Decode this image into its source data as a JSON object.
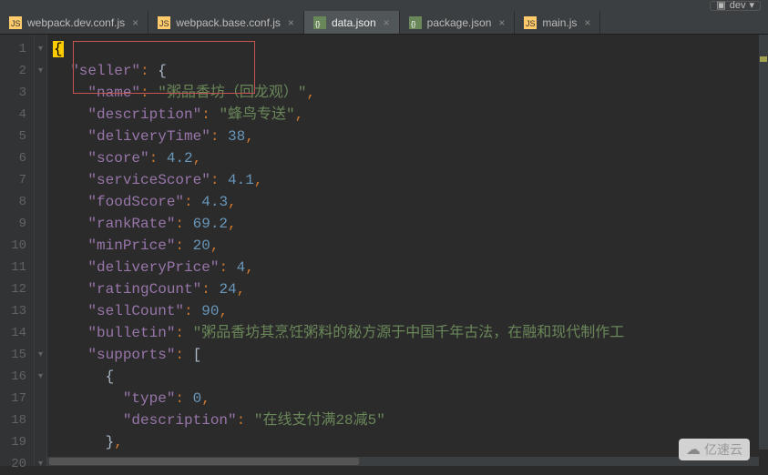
{
  "topbar": {
    "config_name": "dev"
  },
  "tabs": [
    {
      "label": "webpack.dev.conf.js",
      "icon": "js",
      "active": false
    },
    {
      "label": "webpack.base.conf.js",
      "icon": "js",
      "active": false
    },
    {
      "label": "data.json",
      "icon": "json",
      "active": true
    },
    {
      "label": "package.json",
      "icon": "json",
      "active": false
    },
    {
      "label": "main.js",
      "icon": "js",
      "active": false
    }
  ],
  "code": {
    "lines": [
      {
        "num": 1,
        "indent": 0,
        "tokens": [
          {
            "t": "caret",
            "v": "{"
          }
        ]
      },
      {
        "num": 2,
        "indent": 1,
        "tokens": [
          {
            "t": "k",
            "v": "\"seller\""
          },
          {
            "t": "p",
            "v": ": "
          },
          {
            "t": "w",
            "v": "{"
          }
        ]
      },
      {
        "num": 3,
        "indent": 2,
        "tokens": [
          {
            "t": "k",
            "v": "\"name\""
          },
          {
            "t": "p",
            "v": ": "
          },
          {
            "t": "s",
            "v": "\"粥品香坊（回龙观）\""
          },
          {
            "t": "p",
            "v": ","
          }
        ]
      },
      {
        "num": 4,
        "indent": 2,
        "tokens": [
          {
            "t": "k",
            "v": "\"description\""
          },
          {
            "t": "p",
            "v": ": "
          },
          {
            "t": "s",
            "v": "\"蜂鸟专送\""
          },
          {
            "t": "p",
            "v": ","
          }
        ]
      },
      {
        "num": 5,
        "indent": 2,
        "tokens": [
          {
            "t": "k",
            "v": "\"deliveryTime\""
          },
          {
            "t": "p",
            "v": ": "
          },
          {
            "t": "n",
            "v": "38"
          },
          {
            "t": "p",
            "v": ","
          }
        ]
      },
      {
        "num": 6,
        "indent": 2,
        "tokens": [
          {
            "t": "k",
            "v": "\"score\""
          },
          {
            "t": "p",
            "v": ": "
          },
          {
            "t": "n",
            "v": "4.2"
          },
          {
            "t": "p",
            "v": ","
          }
        ]
      },
      {
        "num": 7,
        "indent": 2,
        "tokens": [
          {
            "t": "k",
            "v": "\"serviceScore\""
          },
          {
            "t": "p",
            "v": ": "
          },
          {
            "t": "n",
            "v": "4.1"
          },
          {
            "t": "p",
            "v": ","
          }
        ]
      },
      {
        "num": 8,
        "indent": 2,
        "tokens": [
          {
            "t": "k",
            "v": "\"foodScore\""
          },
          {
            "t": "p",
            "v": ": "
          },
          {
            "t": "n",
            "v": "4.3"
          },
          {
            "t": "p",
            "v": ","
          }
        ]
      },
      {
        "num": 9,
        "indent": 2,
        "tokens": [
          {
            "t": "k",
            "v": "\"rankRate\""
          },
          {
            "t": "p",
            "v": ": "
          },
          {
            "t": "n",
            "v": "69.2"
          },
          {
            "t": "p",
            "v": ","
          }
        ]
      },
      {
        "num": 10,
        "indent": 2,
        "tokens": [
          {
            "t": "k",
            "v": "\"minPrice\""
          },
          {
            "t": "p",
            "v": ": "
          },
          {
            "t": "n",
            "v": "20"
          },
          {
            "t": "p",
            "v": ","
          }
        ]
      },
      {
        "num": 11,
        "indent": 2,
        "tokens": [
          {
            "t": "k",
            "v": "\"deliveryPrice\""
          },
          {
            "t": "p",
            "v": ": "
          },
          {
            "t": "n",
            "v": "4"
          },
          {
            "t": "p",
            "v": ","
          }
        ]
      },
      {
        "num": 12,
        "indent": 2,
        "tokens": [
          {
            "t": "k",
            "v": "\"ratingCount\""
          },
          {
            "t": "p",
            "v": ": "
          },
          {
            "t": "n",
            "v": "24"
          },
          {
            "t": "p",
            "v": ","
          }
        ]
      },
      {
        "num": 13,
        "indent": 2,
        "tokens": [
          {
            "t": "k",
            "v": "\"sellCount\""
          },
          {
            "t": "p",
            "v": ": "
          },
          {
            "t": "n",
            "v": "90"
          },
          {
            "t": "p",
            "v": ","
          }
        ]
      },
      {
        "num": 14,
        "indent": 2,
        "tokens": [
          {
            "t": "k",
            "v": "\"bulletin\""
          },
          {
            "t": "p",
            "v": ": "
          },
          {
            "t": "s",
            "v": "\"粥品香坊其烹饪粥料的秘方源于中国千年古法，在融和现代制作工"
          }
        ]
      },
      {
        "num": 15,
        "indent": 2,
        "tokens": [
          {
            "t": "k",
            "v": "\"supports\""
          },
          {
            "t": "p",
            "v": ": "
          },
          {
            "t": "w",
            "v": "["
          }
        ]
      },
      {
        "num": 16,
        "indent": 3,
        "tokens": [
          {
            "t": "w",
            "v": "{"
          }
        ]
      },
      {
        "num": 17,
        "indent": 4,
        "tokens": [
          {
            "t": "k",
            "v": "\"type\""
          },
          {
            "t": "p",
            "v": ": "
          },
          {
            "t": "n",
            "v": "0"
          },
          {
            "t": "p",
            "v": ","
          }
        ]
      },
      {
        "num": 18,
        "indent": 4,
        "tokens": [
          {
            "t": "k",
            "v": "\"description\""
          },
          {
            "t": "p",
            "v": ": "
          },
          {
            "t": "s",
            "v": "\"在线支付满28减5\""
          }
        ]
      },
      {
        "num": 19,
        "indent": 3,
        "tokens": [
          {
            "t": "w",
            "v": "}"
          },
          {
            "t": "p",
            "v": ","
          }
        ]
      },
      {
        "num": 20,
        "indent": 3,
        "tokens": [
          {
            "t": "w",
            "v": "{"
          }
        ]
      }
    ]
  },
  "watermark": "亿速云"
}
